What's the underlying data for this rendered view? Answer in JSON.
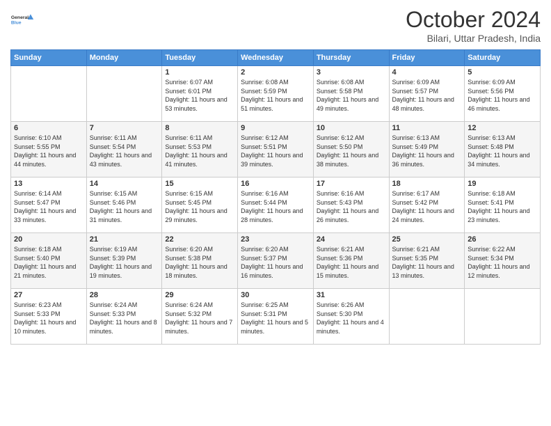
{
  "logo": {
    "line1": "General",
    "line2": "Blue"
  },
  "title": "October 2024",
  "subtitle": "Bilari, Uttar Pradesh, India",
  "days_of_week": [
    "Sunday",
    "Monday",
    "Tuesday",
    "Wednesday",
    "Thursday",
    "Friday",
    "Saturday"
  ],
  "weeks": [
    [
      {
        "day": "",
        "sunrise": "",
        "sunset": "",
        "daylight": ""
      },
      {
        "day": "",
        "sunrise": "",
        "sunset": "",
        "daylight": ""
      },
      {
        "day": "1",
        "sunrise": "Sunrise: 6:07 AM",
        "sunset": "Sunset: 6:01 PM",
        "daylight": "Daylight: 11 hours and 53 minutes."
      },
      {
        "day": "2",
        "sunrise": "Sunrise: 6:08 AM",
        "sunset": "Sunset: 5:59 PM",
        "daylight": "Daylight: 11 hours and 51 minutes."
      },
      {
        "day": "3",
        "sunrise": "Sunrise: 6:08 AM",
        "sunset": "Sunset: 5:58 PM",
        "daylight": "Daylight: 11 hours and 49 minutes."
      },
      {
        "day": "4",
        "sunrise": "Sunrise: 6:09 AM",
        "sunset": "Sunset: 5:57 PM",
        "daylight": "Daylight: 11 hours and 48 minutes."
      },
      {
        "day": "5",
        "sunrise": "Sunrise: 6:09 AM",
        "sunset": "Sunset: 5:56 PM",
        "daylight": "Daylight: 11 hours and 46 minutes."
      }
    ],
    [
      {
        "day": "6",
        "sunrise": "Sunrise: 6:10 AM",
        "sunset": "Sunset: 5:55 PM",
        "daylight": "Daylight: 11 hours and 44 minutes."
      },
      {
        "day": "7",
        "sunrise": "Sunrise: 6:11 AM",
        "sunset": "Sunset: 5:54 PM",
        "daylight": "Daylight: 11 hours and 43 minutes."
      },
      {
        "day": "8",
        "sunrise": "Sunrise: 6:11 AM",
        "sunset": "Sunset: 5:53 PM",
        "daylight": "Daylight: 11 hours and 41 minutes."
      },
      {
        "day": "9",
        "sunrise": "Sunrise: 6:12 AM",
        "sunset": "Sunset: 5:51 PM",
        "daylight": "Daylight: 11 hours and 39 minutes."
      },
      {
        "day": "10",
        "sunrise": "Sunrise: 6:12 AM",
        "sunset": "Sunset: 5:50 PM",
        "daylight": "Daylight: 11 hours and 38 minutes."
      },
      {
        "day": "11",
        "sunrise": "Sunrise: 6:13 AM",
        "sunset": "Sunset: 5:49 PM",
        "daylight": "Daylight: 11 hours and 36 minutes."
      },
      {
        "day": "12",
        "sunrise": "Sunrise: 6:13 AM",
        "sunset": "Sunset: 5:48 PM",
        "daylight": "Daylight: 11 hours and 34 minutes."
      }
    ],
    [
      {
        "day": "13",
        "sunrise": "Sunrise: 6:14 AM",
        "sunset": "Sunset: 5:47 PM",
        "daylight": "Daylight: 11 hours and 33 minutes."
      },
      {
        "day": "14",
        "sunrise": "Sunrise: 6:15 AM",
        "sunset": "Sunset: 5:46 PM",
        "daylight": "Daylight: 11 hours and 31 minutes."
      },
      {
        "day": "15",
        "sunrise": "Sunrise: 6:15 AM",
        "sunset": "Sunset: 5:45 PM",
        "daylight": "Daylight: 11 hours and 29 minutes."
      },
      {
        "day": "16",
        "sunrise": "Sunrise: 6:16 AM",
        "sunset": "Sunset: 5:44 PM",
        "daylight": "Daylight: 11 hours and 28 minutes."
      },
      {
        "day": "17",
        "sunrise": "Sunrise: 6:16 AM",
        "sunset": "Sunset: 5:43 PM",
        "daylight": "Daylight: 11 hours and 26 minutes."
      },
      {
        "day": "18",
        "sunrise": "Sunrise: 6:17 AM",
        "sunset": "Sunset: 5:42 PM",
        "daylight": "Daylight: 11 hours and 24 minutes."
      },
      {
        "day": "19",
        "sunrise": "Sunrise: 6:18 AM",
        "sunset": "Sunset: 5:41 PM",
        "daylight": "Daylight: 11 hours and 23 minutes."
      }
    ],
    [
      {
        "day": "20",
        "sunrise": "Sunrise: 6:18 AM",
        "sunset": "Sunset: 5:40 PM",
        "daylight": "Daylight: 11 hours and 21 minutes."
      },
      {
        "day": "21",
        "sunrise": "Sunrise: 6:19 AM",
        "sunset": "Sunset: 5:39 PM",
        "daylight": "Daylight: 11 hours and 19 minutes."
      },
      {
        "day": "22",
        "sunrise": "Sunrise: 6:20 AM",
        "sunset": "Sunset: 5:38 PM",
        "daylight": "Daylight: 11 hours and 18 minutes."
      },
      {
        "day": "23",
        "sunrise": "Sunrise: 6:20 AM",
        "sunset": "Sunset: 5:37 PM",
        "daylight": "Daylight: 11 hours and 16 minutes."
      },
      {
        "day": "24",
        "sunrise": "Sunrise: 6:21 AM",
        "sunset": "Sunset: 5:36 PM",
        "daylight": "Daylight: 11 hours and 15 minutes."
      },
      {
        "day": "25",
        "sunrise": "Sunrise: 6:21 AM",
        "sunset": "Sunset: 5:35 PM",
        "daylight": "Daylight: 11 hours and 13 minutes."
      },
      {
        "day": "26",
        "sunrise": "Sunrise: 6:22 AM",
        "sunset": "Sunset: 5:34 PM",
        "daylight": "Daylight: 11 hours and 12 minutes."
      }
    ],
    [
      {
        "day": "27",
        "sunrise": "Sunrise: 6:23 AM",
        "sunset": "Sunset: 5:33 PM",
        "daylight": "Daylight: 11 hours and 10 minutes."
      },
      {
        "day": "28",
        "sunrise": "Sunrise: 6:24 AM",
        "sunset": "Sunset: 5:33 PM",
        "daylight": "Daylight: 11 hours and 8 minutes."
      },
      {
        "day": "29",
        "sunrise": "Sunrise: 6:24 AM",
        "sunset": "Sunset: 5:32 PM",
        "daylight": "Daylight: 11 hours and 7 minutes."
      },
      {
        "day": "30",
        "sunrise": "Sunrise: 6:25 AM",
        "sunset": "Sunset: 5:31 PM",
        "daylight": "Daylight: 11 hours and 5 minutes."
      },
      {
        "day": "31",
        "sunrise": "Sunrise: 6:26 AM",
        "sunset": "Sunset: 5:30 PM",
        "daylight": "Daylight: 11 hours and 4 minutes."
      },
      {
        "day": "",
        "sunrise": "",
        "sunset": "",
        "daylight": ""
      },
      {
        "day": "",
        "sunrise": "",
        "sunset": "",
        "daylight": ""
      }
    ]
  ]
}
